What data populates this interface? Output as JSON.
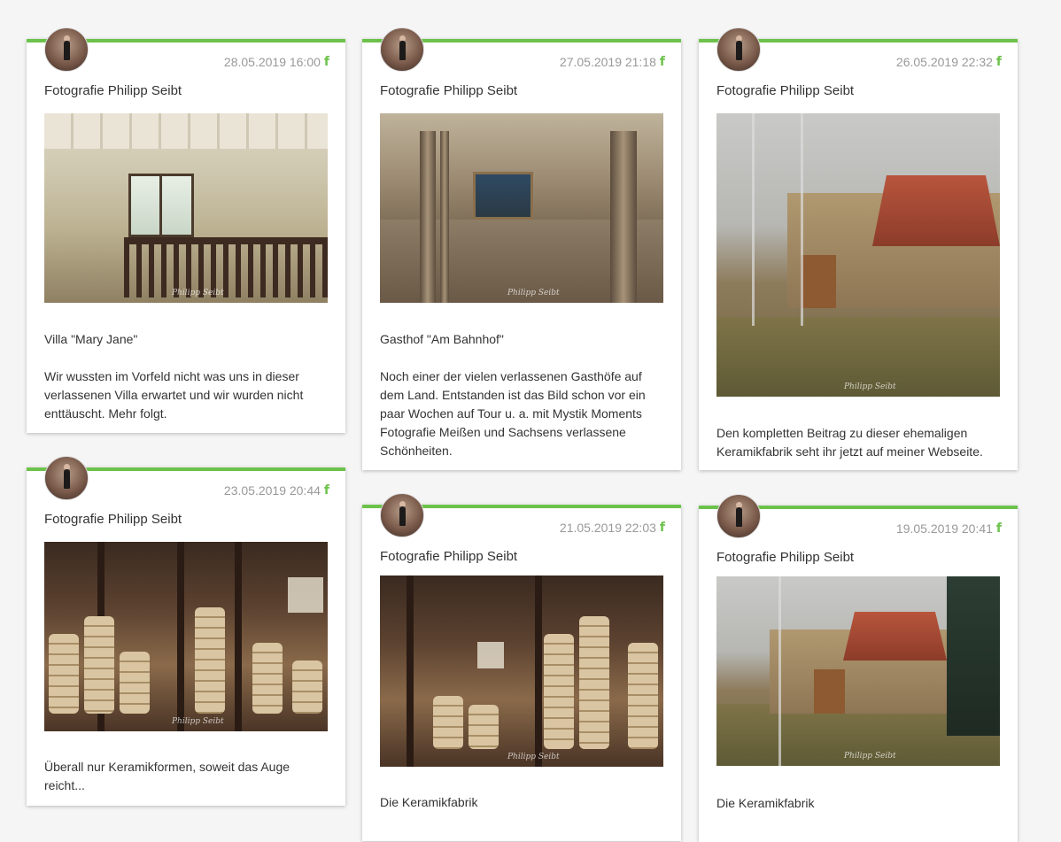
{
  "cards": [
    {
      "date": "28.05.2019 16:00",
      "author": "Fotografie Philipp Seibt",
      "watermark": "Philipp Seibt",
      "lines": [
        "Villa \"Mary Jane\"",
        "",
        "Wir wussten im Vorfeld nicht was uns in dieser",
        "verlassenen Villa erwartet und wir wurden nicht",
        "enttäuscht. Mehr folgt."
      ]
    },
    {
      "date": "27.05.2019 21:18",
      "author": "Fotografie Philipp Seibt",
      "watermark": "Philipp Seibt",
      "lines": [
        "Gasthof \"Am Bahnhof\"",
        "",
        "Noch einer der vielen verlassenen Gasthöfe auf",
        "dem Land. Entstanden ist das Bild schon vor ein",
        "paar Wochen auf Tour u. a. mit Mystik Moments",
        "Fotografie Meißen und Sachsens verlassene",
        "Schönheiten."
      ]
    },
    {
      "date": "26.05.2019 22:32",
      "author": "Fotografie Philipp Seibt",
      "watermark": "Philipp Seibt",
      "lines": [
        "Den kompletten Beitrag zu dieser ehemaligen",
        "Keramikfabrik seht ihr jetzt auf meiner Webseite."
      ]
    },
    {
      "date": "23.05.2019 20:44",
      "author": "Fotografie Philipp Seibt",
      "watermark": "Philipp Seibt",
      "lines": [
        "Überall nur Keramikformen, soweit das Auge",
        "reicht..."
      ]
    },
    {
      "date": "21.05.2019 22:03",
      "author": "Fotografie Philipp Seibt",
      "watermark": "Philipp Seibt",
      "lines": [
        "Die Keramikfabrik"
      ]
    },
    {
      "date": "19.05.2019 20:41",
      "author": "Fotografie Philipp Seibt",
      "watermark": "Philipp Seibt",
      "lines": [
        "Die Keramikfabrik"
      ]
    }
  ],
  "colors": {
    "accent": "#6cc24a",
    "date": "#999999",
    "text": "#333333",
    "background": "#f5f5f5"
  },
  "icons": {
    "source": "facebook-icon",
    "avatar": "author-avatar"
  }
}
